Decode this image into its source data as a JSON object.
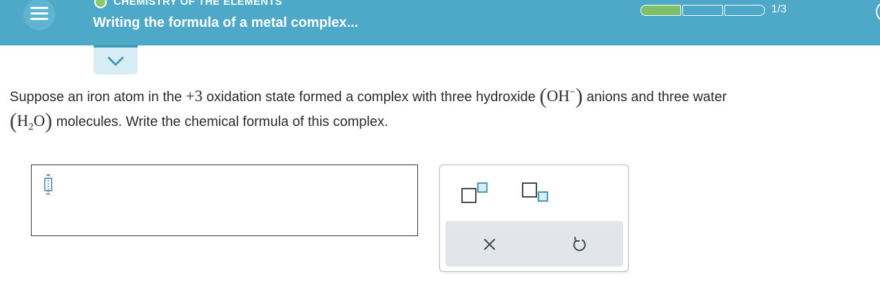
{
  "header": {
    "topic": "CHEMISTRY OF THE ELEMENTS",
    "title": "Writing the formula of a metal complex...",
    "progress": {
      "current": 1,
      "total": 3,
      "label": "1/3",
      "segments_filled": 1,
      "segments_total": 3
    },
    "colors": {
      "bar": "#4ea9c8",
      "progress_fill": "#7fc06a"
    }
  },
  "question": {
    "line1_a": "Suppose an iron atom in the ",
    "charge": "+3",
    "line1_b": " oxidation state formed a complex with three hydroxide ",
    "oh_base": "OH",
    "oh_charge": "−",
    "line1_c": " anions and three water",
    "h2o_h": "H",
    "h2o_sub": "2",
    "h2o_o": "O",
    "line2": " molecules. Write the chemical formula of this complex."
  },
  "answer": {
    "value": ""
  },
  "palette": {
    "tools": [
      "superscript-icon",
      "subscript-icon"
    ],
    "actions": [
      "clear-icon",
      "undo-icon"
    ]
  }
}
